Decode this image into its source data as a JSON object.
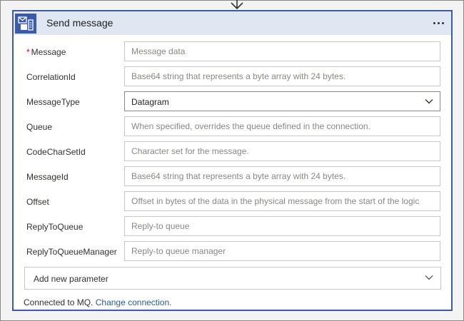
{
  "card": {
    "title": "Send message",
    "icon": "mq-connector-icon",
    "more_icon": "more-options-icon"
  },
  "fields": [
    {
      "label": "Message",
      "required": true,
      "placeholder": "Message data",
      "value": ""
    },
    {
      "label": "CorrelationId",
      "required": false,
      "placeholder": "Base64 string that represents a byte array with 24 bytes.",
      "value": ""
    },
    {
      "label": "MessageType",
      "required": false,
      "type": "select",
      "value": "Datagram"
    },
    {
      "label": "Queue",
      "required": false,
      "placeholder": "When specified, overrides the queue defined in the connection.",
      "value": ""
    },
    {
      "label": "CodeCharSetId",
      "required": false,
      "placeholder": "Character set for the message.",
      "value": ""
    },
    {
      "label": "MessageId",
      "required": false,
      "placeholder": "Base64 string that represents a byte array with 24 bytes.",
      "value": ""
    },
    {
      "label": "Offset",
      "required": false,
      "placeholder": "Offset in bytes of the data in the physical message from the start of the logic",
      "value": ""
    },
    {
      "label": "ReplyToQueue",
      "required": false,
      "placeholder": "Reply-to queue",
      "value": ""
    },
    {
      "label": "ReplyToQueueManager",
      "required": false,
      "placeholder": "Reply-to queue manager",
      "value": ""
    }
  ],
  "add_parameter": {
    "label": "Add new parameter"
  },
  "footer": {
    "text": "Connected to MQ.",
    "link": "Change connection."
  },
  "colors": {
    "accent": "#3a5ca8",
    "header_bg": "#e1e6f3",
    "link": "#2a5b9c",
    "required": "#c50f1f"
  }
}
